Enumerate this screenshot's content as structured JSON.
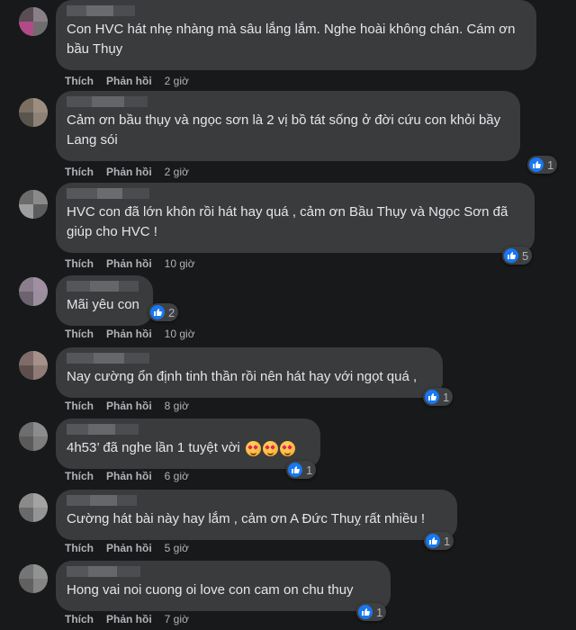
{
  "colors": {
    "background": "#18191a",
    "bubble": "#3a3b3c",
    "text": "#e4e6eb",
    "secondary": "#b0b3b8",
    "like": "#1877f2"
  },
  "comments": [
    {
      "text": "Con HVC hát nhẹ nhàng mà sâu lắng lắm. Nghe hoài không chán. Cám ơn bầu Thụy",
      "like_label": "Thích",
      "reply_label": "Phản hồi",
      "time": "2 giờ",
      "reaction_count": "",
      "emojis": []
    },
    {
      "text": "Cảm ơn bầu thụy và ngọc sơn là 2 vị bồ tát sống ở đời cứu con khỏi bầy Lang sói",
      "like_label": "Thích",
      "reply_label": "Phản hồi",
      "time": "2 giờ",
      "reaction_count": "1",
      "reaction_icon": "like-icon",
      "emojis": []
    },
    {
      "text": "HVC con đã lớn khôn rồi hát hay quá , cảm ơn Bầu Thụy và Ngọc Sơn đã giúp cho HVC !",
      "like_label": "Thích",
      "reply_label": "Phản hồi",
      "time": "10 giờ",
      "reaction_count": "5",
      "reaction_icon": "like-icon",
      "emojis": []
    },
    {
      "text": "Mãi yêu con",
      "like_label": "Thích",
      "reply_label": "Phản hồi",
      "time": "10 giờ",
      "reaction_count": "2",
      "reaction_icon": "like-icon",
      "emojis": []
    },
    {
      "text": "Nay cường ổn định tinh thần rồi nên hát hay với ngọt quá ,",
      "like_label": "Thích",
      "reply_label": "Phản hồi",
      "time": "8 giờ",
      "reaction_count": "1",
      "reaction_icon": "like-icon",
      "emojis": []
    },
    {
      "text": "4h53’ đã nghe lần 1 tuyệt vời",
      "like_label": "Thích",
      "reply_label": "Phản hồi",
      "time": "6 giờ",
      "reaction_count": "1",
      "reaction_icon": "like-icon",
      "emojis": [
        "smiling-face-with-hearts-icon",
        "smiling-face-with-hearts-icon",
        "smiling-face-with-hearts-icon"
      ]
    },
    {
      "text": "Cường hát bài này hay lắm , cảm ơn A Đức Thuỵ rất nhiều !",
      "like_label": "Thích",
      "reply_label": "Phản hồi",
      "time": "5 giờ",
      "reaction_count": "1",
      "reaction_icon": "like-icon",
      "emojis": []
    },
    {
      "text": "Hong vai noi cuong oi love con cam on chu thuy",
      "like_label": "Thích",
      "reply_label": "Phản hồi",
      "time": "7 giờ",
      "reaction_count": "1",
      "reaction_icon": "like-icon",
      "emojis": []
    }
  ]
}
